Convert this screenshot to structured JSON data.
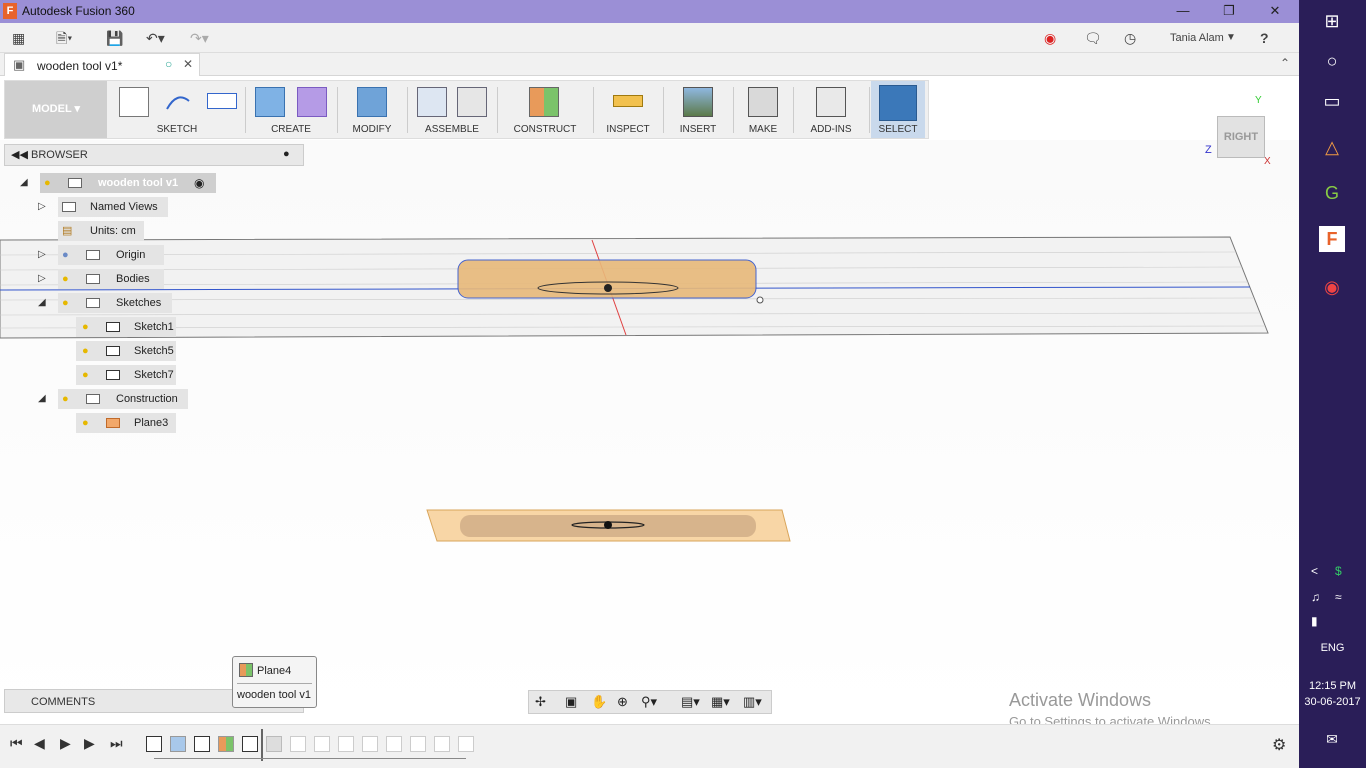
{
  "window": {
    "title": "Autodesk Fusion 360",
    "logo_letter": "F"
  },
  "qat": {
    "user": "Tania Alam",
    "help": "?"
  },
  "tab": {
    "label": "wooden tool v1*"
  },
  "toolbar": {
    "model": "MODEL",
    "groups": [
      "SKETCH",
      "CREATE",
      "MODIFY",
      "ASSEMBLE",
      "CONSTRUCT",
      "INSPECT",
      "INSERT",
      "MAKE",
      "ADD-INS",
      "SELECT"
    ]
  },
  "browser": {
    "title": "BROWSER",
    "root": "wooden tool v1",
    "named_views": "Named Views",
    "units": "Units: cm",
    "origin": "Origin",
    "bodies": "Bodies",
    "sketches": "Sketches",
    "sketch_items": [
      "Sketch1",
      "Sketch5",
      "Sketch7"
    ],
    "construction": "Construction",
    "construction_items": [
      "Plane3"
    ]
  },
  "comments": {
    "label": "COMMENTS"
  },
  "tooltip": {
    "title": "Plane4",
    "subtitle": "wooden tool v1"
  },
  "viewcube": {
    "face": "RIGHT",
    "axis_y": "Y",
    "axis_z": "Z",
    "axis_x": "X"
  },
  "activation": {
    "line1": "Activate Windows",
    "line2": "Go to Settings to activate Windows."
  },
  "taskbar": {
    "lang": "ENG",
    "time": "12:15 PM",
    "date": "30-06-2017"
  },
  "colors": {
    "titlebar": "#9b8fd6",
    "taskbar": "#2a1e58",
    "select_active": "#3b78b9",
    "body": "#e8b97a"
  }
}
